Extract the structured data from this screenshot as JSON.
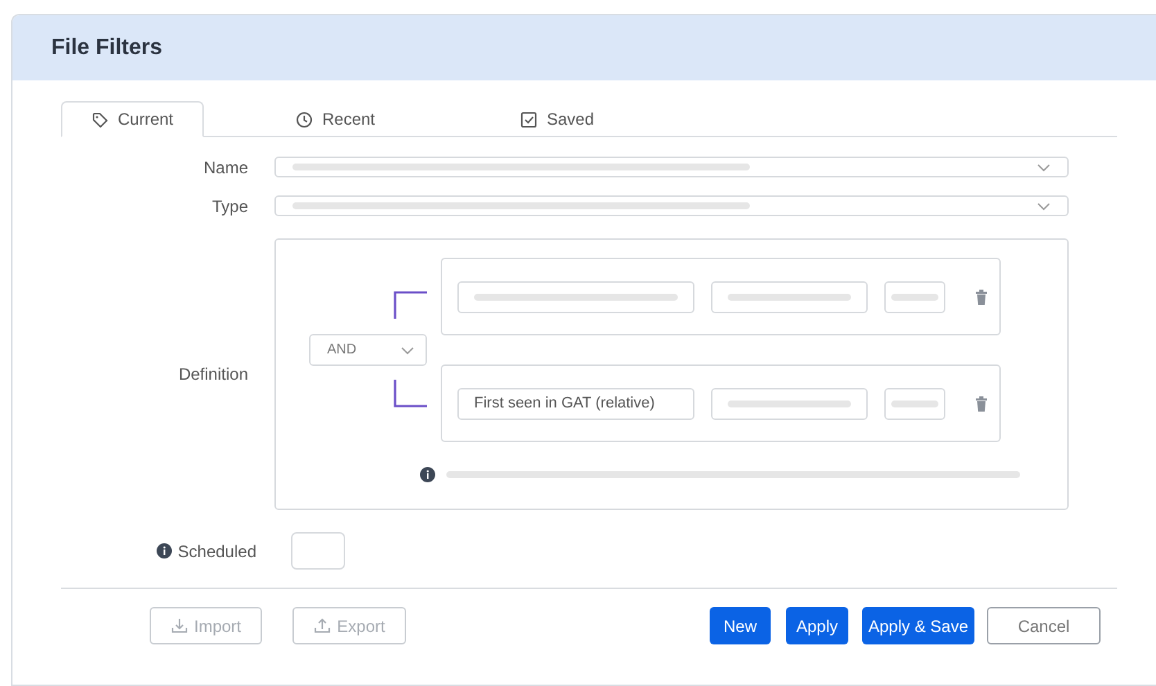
{
  "window": {
    "title": "File Filters"
  },
  "tabs": [
    {
      "label": "Current",
      "selected": true
    },
    {
      "label": "Recent",
      "selected": false
    },
    {
      "label": "Saved",
      "selected": false
    }
  ],
  "fields": [
    {
      "label": "Name"
    },
    {
      "label": "Type"
    }
  ],
  "definition": {
    "label": "Definition",
    "operator": "AND",
    "conditions": [
      {
        "kind": "loading"
      },
      {
        "kind": "text",
        "field": "First seen in GAT (relative)"
      }
    ]
  },
  "scheduled": {
    "label": "Scheduled",
    "checked": false
  },
  "buttons": [
    {
      "label": "Import",
      "kind": "secondary",
      "disabled": true
    },
    {
      "label": "Export",
      "kind": "secondary",
      "disabled": true
    },
    {
      "label": "New",
      "kind": "primary",
      "disabled": false
    },
    {
      "label": "Apply",
      "kind": "primary",
      "disabled": false
    },
    {
      "label": "Apply & Save",
      "kind": "primary",
      "disabled": false
    },
    {
      "label": "Cancel",
      "kind": "secondary",
      "disabled": false
    }
  ]
}
